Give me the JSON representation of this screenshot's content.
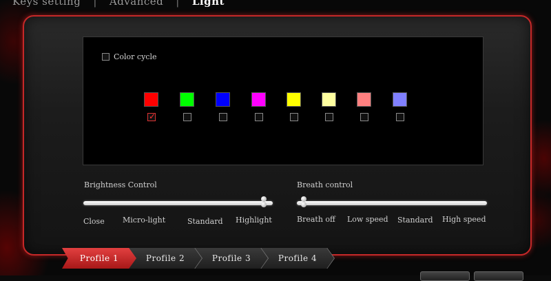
{
  "tabs": [
    "Keys setting",
    "Advanced",
    "Light"
  ],
  "active_tab": "Light",
  "color_cycle": {
    "label": "Color cycle",
    "checked": false
  },
  "colors": [
    {
      "hex": "#ff0000",
      "checked": true
    },
    {
      "hex": "#00ff00",
      "checked": false
    },
    {
      "hex": "#0000ff",
      "checked": false
    },
    {
      "hex": "#ff00ff",
      "checked": false
    },
    {
      "hex": "#ffff00",
      "checked": false
    },
    {
      "hex": "#ffffa0",
      "checked": false
    },
    {
      "hex": "#ff8080",
      "checked": false
    },
    {
      "hex": "#8080ff",
      "checked": false
    }
  ],
  "brightness": {
    "title": "Brightness Control",
    "labels": [
      "Close",
      "Micro-light",
      "Standard",
      "Highlight"
    ],
    "value": "Highlight"
  },
  "breath": {
    "title": "Breath control",
    "labels": [
      "Breath off",
      "Low speed",
      "Standard",
      "High speed"
    ],
    "value": "Breath off"
  },
  "profiles": [
    "Profile 1",
    "Profile 2",
    "Profile 3",
    "Profile 4"
  ],
  "active_profile": "Profile 1",
  "accent_color": "#c62828"
}
